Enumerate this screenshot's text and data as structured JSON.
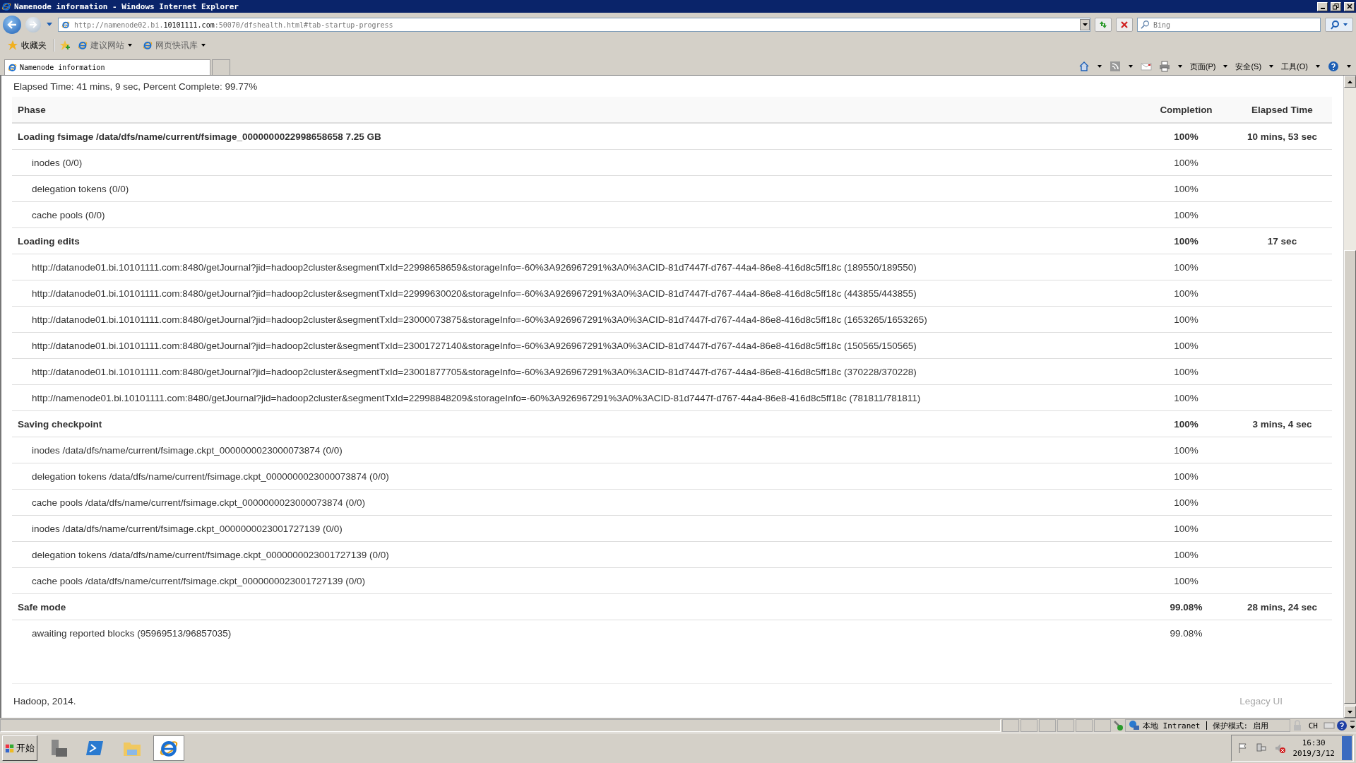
{
  "window": {
    "title": "Namenode information - Windows Internet Explorer"
  },
  "address_bar": {
    "url_prefix": "http://namenode02.bi.",
    "url_domain": "10101111.com",
    "url_suffix": ":50070/dfshealth.html#tab-startup-progress"
  },
  "search": {
    "placeholder": "Bing"
  },
  "favorites_bar": {
    "label": "收藏夹",
    "items": [
      "建议网站",
      "网页快讯库"
    ]
  },
  "tabs": [
    {
      "label": "Namenode information",
      "selected": true
    }
  ],
  "command_bar": [
    "页面(P)",
    "安全(S)",
    "工具(O)"
  ],
  "page": {
    "elapsed": "Elapsed Time: 41 mins, 9 sec, Percent Complete: 99.77%",
    "table": {
      "columns": [
        "Phase",
        "Completion",
        "Elapsed Time"
      ],
      "phases": [
        {
          "name": "Loading fsimage /data/dfs/name/current/fsimage_0000000022998658658 7.25 GB",
          "completion": "100%",
          "elapsed": "10 mins, 53 sec",
          "steps": [
            {
              "name": "inodes (0/0)",
              "completion": "100%"
            },
            {
              "name": "delegation tokens (0/0)",
              "completion": "100%"
            },
            {
              "name": "cache pools (0/0)",
              "completion": "100%"
            }
          ]
        },
        {
          "name": "Loading edits",
          "completion": "100%",
          "elapsed": "17 sec",
          "steps": [
            {
              "name": "http://datanode01.bi.10101111.com:8480/getJournal?jid=hadoop2cluster&segmentTxId=22998658659&storageInfo=-60%3A926967291%3A0%3ACID-81d7447f-d767-44a4-86e8-416d8c5ff18c (189550/189550)",
              "completion": "100%"
            },
            {
              "name": "http://datanode01.bi.10101111.com:8480/getJournal?jid=hadoop2cluster&segmentTxId=22999630020&storageInfo=-60%3A926967291%3A0%3ACID-81d7447f-d767-44a4-86e8-416d8c5ff18c (443855/443855)",
              "completion": "100%"
            },
            {
              "name": "http://datanode01.bi.10101111.com:8480/getJournal?jid=hadoop2cluster&segmentTxId=23000073875&storageInfo=-60%3A926967291%3A0%3ACID-81d7447f-d767-44a4-86e8-416d8c5ff18c (1653265/1653265)",
              "completion": "100%"
            },
            {
              "name": "http://datanode01.bi.10101111.com:8480/getJournal?jid=hadoop2cluster&segmentTxId=23001727140&storageInfo=-60%3A926967291%3A0%3ACID-81d7447f-d767-44a4-86e8-416d8c5ff18c (150565/150565)",
              "completion": "100%"
            },
            {
              "name": "http://datanode01.bi.10101111.com:8480/getJournal?jid=hadoop2cluster&segmentTxId=23001877705&storageInfo=-60%3A926967291%3A0%3ACID-81d7447f-d767-44a4-86e8-416d8c5ff18c (370228/370228)",
              "completion": "100%"
            },
            {
              "name": "http://namenode01.bi.10101111.com:8480/getJournal?jid=hadoop2cluster&segmentTxId=22998848209&storageInfo=-60%3A926967291%3A0%3ACID-81d7447f-d767-44a4-86e8-416d8c5ff18c (781811/781811)",
              "completion": "100%"
            }
          ]
        },
        {
          "name": "Saving checkpoint",
          "completion": "100%",
          "elapsed": "3 mins, 4 sec",
          "steps": [
            {
              "name": "inodes /data/dfs/name/current/fsimage.ckpt_0000000023000073874 (0/0)",
              "completion": "100%"
            },
            {
              "name": "delegation tokens /data/dfs/name/current/fsimage.ckpt_0000000023000073874 (0/0)",
              "completion": "100%"
            },
            {
              "name": "cache pools /data/dfs/name/current/fsimage.ckpt_0000000023000073874 (0/0)",
              "completion": "100%"
            },
            {
              "name": "inodes /data/dfs/name/current/fsimage.ckpt_0000000023001727139 (0/0)",
              "completion": "100%"
            },
            {
              "name": "delegation tokens /data/dfs/name/current/fsimage.ckpt_0000000023001727139 (0/0)",
              "completion": "100%"
            },
            {
              "name": "cache pools /data/dfs/name/current/fsimage.ckpt_0000000023001727139 (0/0)",
              "completion": "100%"
            }
          ]
        },
        {
          "name": "Safe mode",
          "completion": "99.08%",
          "elapsed": "28 mins, 24 sec",
          "steps": [
            {
              "name": "awaiting reported blocks (95969513/96857035)",
              "completion": "99.08%"
            }
          ]
        }
      ]
    },
    "footer": {
      "copyright": "Hadoop, 2014.",
      "legacy_link": "Legacy UI"
    }
  },
  "status_bar": {
    "zone": "本地 Intranet",
    "protected_mode": "保护模式: 启用",
    "language": "CH"
  },
  "taskbar": {
    "start": "开始",
    "time": "16:30",
    "date": "2019/3/12"
  }
}
